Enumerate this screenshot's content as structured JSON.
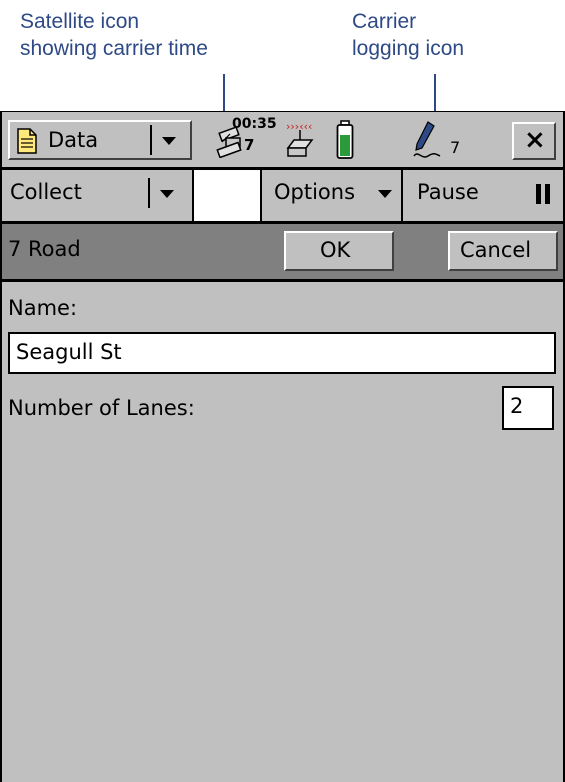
{
  "annotations": {
    "satellite_callout": "Satellite icon\nshowing carrier time",
    "logging_callout": "Carrier\nlogging icon"
  },
  "titlebar": {
    "app_menu_label": "Data",
    "carrier_time": "00:35",
    "satellite_count": "7",
    "logging_count": "7",
    "close_symbol": "×"
  },
  "toolbar": {
    "collect_label": "Collect",
    "options_label": "Options",
    "pause_label": "Pause"
  },
  "feature_bar": {
    "feature_name": "7 Road",
    "ok_label": "OK",
    "cancel_label": "Cancel"
  },
  "form": {
    "name_label": "Name:",
    "name_value": "Seagull St",
    "lanes_label": "Number of Lanes:",
    "lanes_value": "2"
  },
  "colors": {
    "annotation": "#2e4a86",
    "chrome": "#c0c0c0",
    "feature_bar": "#808080",
    "battery": "#2a9a3a",
    "signal": "#cc2222"
  },
  "icons": [
    "document-icon",
    "satellite-icon",
    "radio-signal-icon",
    "battery-icon",
    "pen-logging-icon",
    "close-icon",
    "pause-icon",
    "dropdown-arrow-icon"
  ]
}
